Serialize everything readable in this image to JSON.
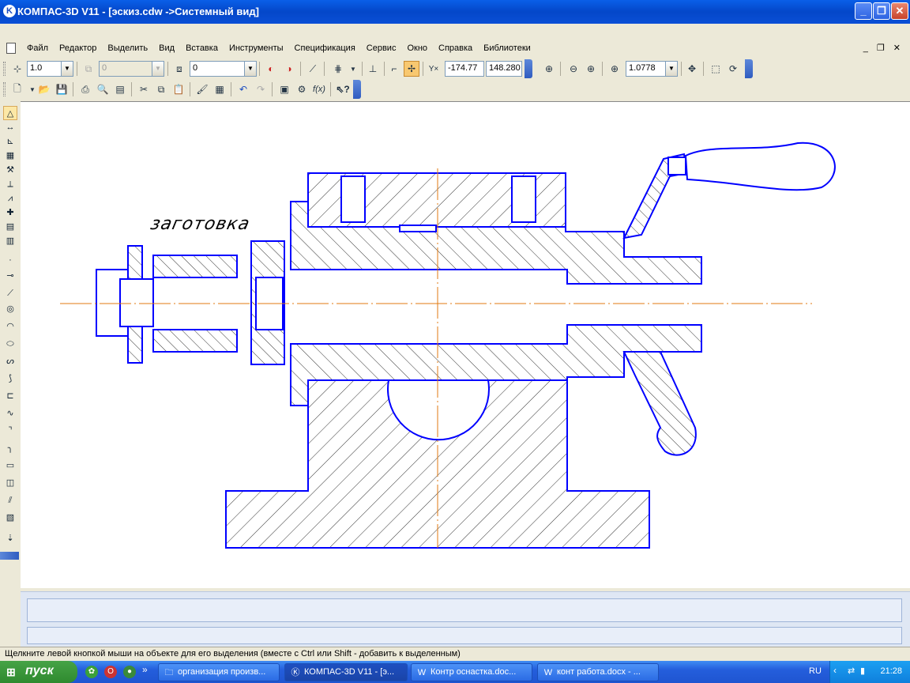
{
  "window": {
    "app_icon": "K",
    "title": "КОМПАС-3D V11 - [эскиз.cdw ->Системный вид]",
    "minimize": "_",
    "restore": "❐",
    "close": "✕"
  },
  "menu": {
    "items": [
      "Файл",
      "Редактор",
      "Выделить",
      "Вид",
      "Вставка",
      "Инструменты",
      "Спецификация",
      "Сервис",
      "Окно",
      "Справка",
      "Библиотеки"
    ],
    "mdi_controls": "_ ❐ ✕"
  },
  "toolbar1": {
    "line_scale": "1.0",
    "disabled_field": "0",
    "layer": "0",
    "coord_x": "-174.77",
    "coord_y": "148.280",
    "zoom": "1.0778"
  },
  "canvas": {
    "annotation": "заготовка",
    "colors": {
      "outline": "#0000FF",
      "hatch": "#000000",
      "axis": "#E07A10"
    }
  },
  "statusbar": {
    "hint": "Щелкните левой кнопкой мыши на объекте для его выделения (вместе с Ctrl или Shift - добавить к выделенным)"
  },
  "taskbar": {
    "start_label": "пуск",
    "tasks": [
      {
        "label": "организация произв...",
        "icon": "folder-icon"
      },
      {
        "label": "КОМПАС-3D V11 - [э...",
        "icon": "kompas-icon"
      },
      {
        "label": "Контр оснастка.doc...",
        "icon": "word-icon"
      },
      {
        "label": "конт работа.docx - ...",
        "icon": "word-icon"
      }
    ],
    "language": "RU",
    "clock": "21:28"
  }
}
